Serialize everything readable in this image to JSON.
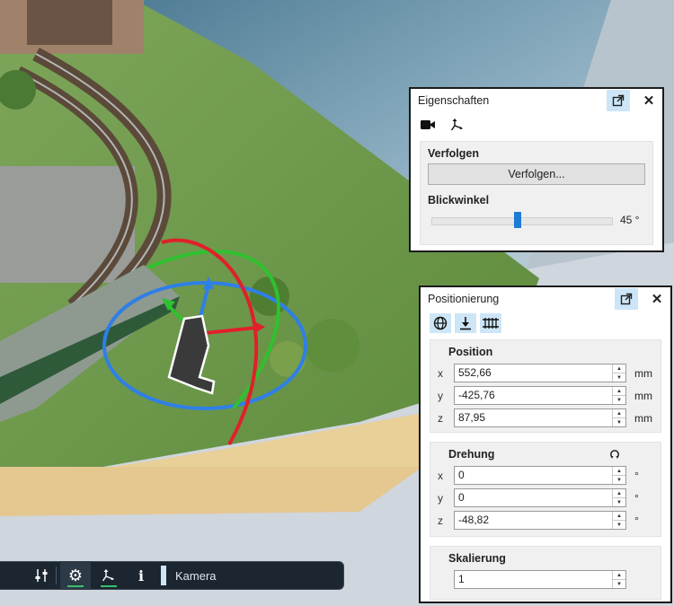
{
  "eigenschaften": {
    "title": "Eigenschaften",
    "follow_heading": "Verfolgen",
    "follow_button": "Verfolgen...",
    "view_angle_heading": "Blickwinkel",
    "view_angle_value": "45 °",
    "view_angle_fraction": 0.48,
    "icons": [
      "camera-icon",
      "move-icon",
      "popout-icon",
      "close-icon"
    ]
  },
  "positionierung": {
    "title": "Positionierung",
    "icons": [
      "globe-icon",
      "download-icon",
      "track-icon",
      "rotate-reset-icon",
      "popout-icon",
      "close-icon"
    ],
    "position": {
      "heading": "Position",
      "rows": [
        {
          "axis": "x",
          "value": "552,66",
          "unit": "mm"
        },
        {
          "axis": "y",
          "value": "-425,76",
          "unit": "mm"
        },
        {
          "axis": "z",
          "value": "87,95",
          "unit": "mm"
        }
      ]
    },
    "drehung": {
      "heading": "Drehung",
      "rows": [
        {
          "axis": "x",
          "value": "0",
          "unit": "°"
        },
        {
          "axis": "y",
          "value": "0",
          "unit": "°"
        },
        {
          "axis": "z",
          "value": "-48,82",
          "unit": "°"
        }
      ]
    },
    "skalierung": {
      "heading": "Skalierung",
      "value": "1"
    }
  },
  "bottombar": {
    "label": "Kamera",
    "icons": [
      "sliders-icon",
      "gear-icon",
      "move-icon",
      "info-icon"
    ]
  },
  "colors": {
    "accent": "#1e7bd6",
    "titlebar_button": "#cde6f7",
    "toolbar_bg": "#1c2630",
    "gizmo_x": "#e0202a",
    "gizmo_y": "#2fc12f",
    "gizmo_z": "#2f7fe6"
  }
}
